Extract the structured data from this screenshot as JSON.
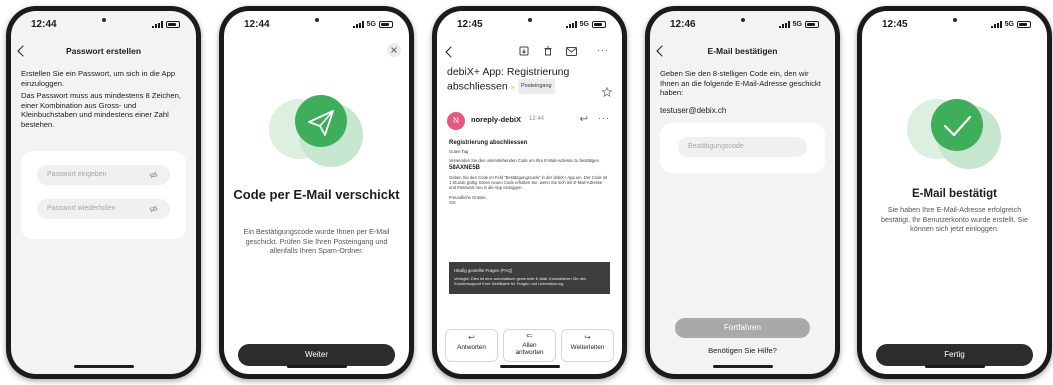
{
  "phones": [
    {
      "time": "12:44",
      "title": "Passwort erstellen",
      "intro": "Erstellen Sie ein Passwort, um sich in die App einzuloggen.",
      "rules": "Das Passwort muss aus mindestens 8 Zeichen, einer Kombination aus Gross- und Kleinbuchstaben und mindestens einer Zahl bestehen.",
      "password_placeholder": "Passwort eingeben",
      "repeat_placeholder": "Passwort wiederholen"
    },
    {
      "time": "12:44",
      "network": "5G",
      "headline": "Code per E-Mail verschickt",
      "description": "Ein Bestätigungscode wurde Ihnen per E-Mail geschickt. Prüfen Sie Ihren Posteingang und allenfalls Ihren Spam-Ordner.",
      "button": "Weiter"
    },
    {
      "time": "12:45",
      "network": "5G",
      "subject": "debiX+ App: Registrierung abschliessen",
      "tag": "Posteingang",
      "sender": "noreply-debiX",
      "sender_time": "12:44",
      "avatar_letter": "N",
      "body_title": "Registrierung abschliessen",
      "greeting": "Guten Tag",
      "line1": "Verwenden Sie den untenstehenden Code um Ihre E-Mail-Adresse zu bestätigen",
      "code": "58AXNE5B",
      "line2": "Geben Sie den Code im Feld \"Bestätigungscode\" in der debiX+ App ein. Der Code ist 1 Stunde gültig. Einen neuen Code erhalten Sie, wenn Sie sich mit E-Mail-Adresse und Passwort neu in die App einloggen.",
      "closing": "Freundliche Grüsse,",
      "signature": "SIX",
      "faq_title": "Häufig gestellte Fragen (FAQ)",
      "faq_text": "Verlegte: Dies ist eine automatisch generierte E-Mail. Kontaktieren Sie den Kundensupport Ihrer Debitkarte für Fragen und Unterstützung.",
      "actions": [
        "Antworten",
        "Allen antworten",
        "Weiterleiten"
      ]
    },
    {
      "time": "12:46",
      "network": "5G",
      "title": "E-Mail bestätigen",
      "instruction": "Geben Sie den 8-stelligen Code ein, den wir Ihnen an die folgende E-Mail-Adresse geschickt haben:",
      "email": "testuser@debix.ch",
      "code_placeholder": "Bestätigungscode",
      "button": "Fortfahren",
      "help": "Benötigen Sie Hilfe?"
    },
    {
      "time": "12:45",
      "network": "5G",
      "headline": "E-Mail bestätigt",
      "description": "Sie haben Ihre E-Mail-Adresse erfolgreich bestätigt. Ihr Benutzerkonto wurde erstellt. Sie können sich jetzt einloggen.",
      "button": "Fertig"
    }
  ],
  "colors": {
    "accent_green": "#3fae5a",
    "button_dark": "#2c2c2e",
    "button_disabled": "#a9a9ac",
    "avatar": "#e8577f"
  }
}
